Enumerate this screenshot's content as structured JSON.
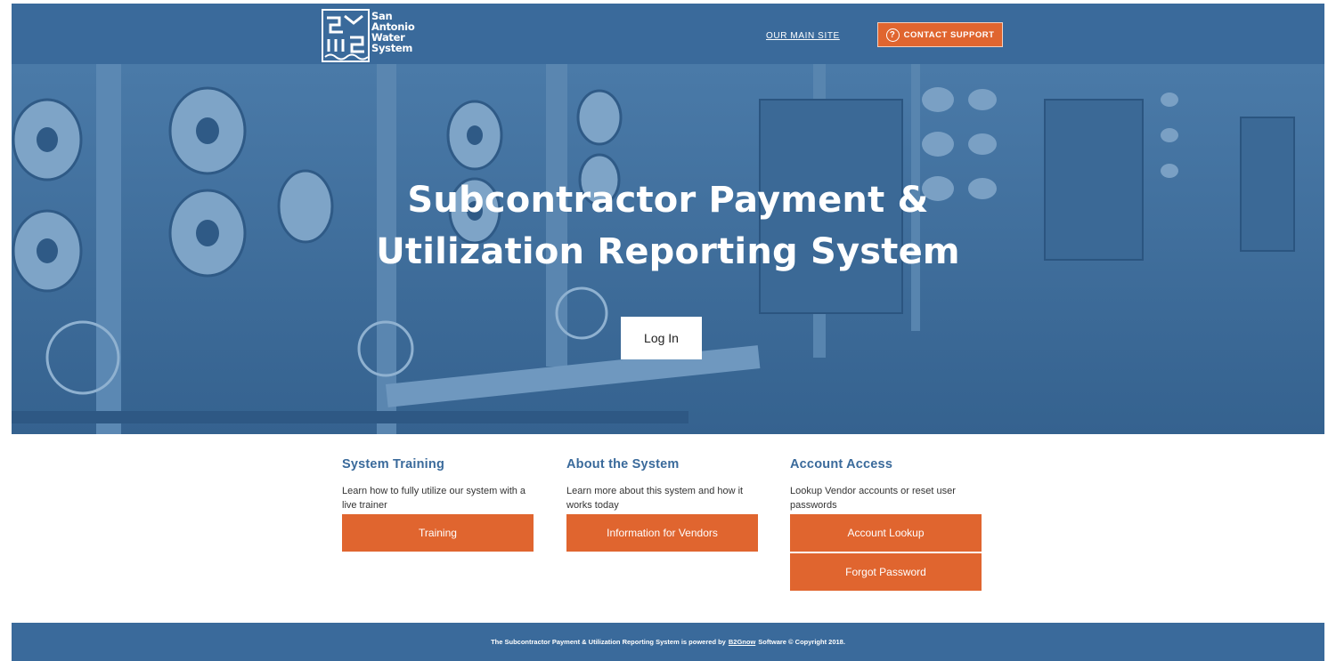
{
  "header": {
    "logo_lines": [
      "San",
      "Antonio",
      "Water",
      "System"
    ],
    "main_site_label": "OUR MAIN SITE",
    "support_icon": "?",
    "support_label": "CONTACT SUPPORT"
  },
  "hero": {
    "title_line1": "Subcontractor Payment &",
    "title_line2": "Utilization Reporting System",
    "login_label": "Log In"
  },
  "sections": [
    {
      "title": "System Training",
      "description": "Learn how to fully utilize our system with a live trainer",
      "buttons": [
        "Training"
      ]
    },
    {
      "title": "About the System",
      "description": "Learn more about this system and how it works today",
      "buttons": [
        "Information for Vendors"
      ]
    },
    {
      "title": "Account Access",
      "description": "Lookup Vendor accounts or reset user passwords",
      "buttons": [
        "Account Lookup",
        "Forgot Password"
      ]
    }
  ],
  "footer": {
    "prefix": "The Subcontractor Payment & Utilization Reporting System is powered by",
    "link": "B2Gnow",
    "suffix": "Software © Copyright 2018."
  },
  "colors": {
    "brand_blue": "#3a6a9b",
    "accent_orange": "#e0652f"
  },
  "icons": [
    "saws-logo",
    "question-circle-icon"
  ]
}
